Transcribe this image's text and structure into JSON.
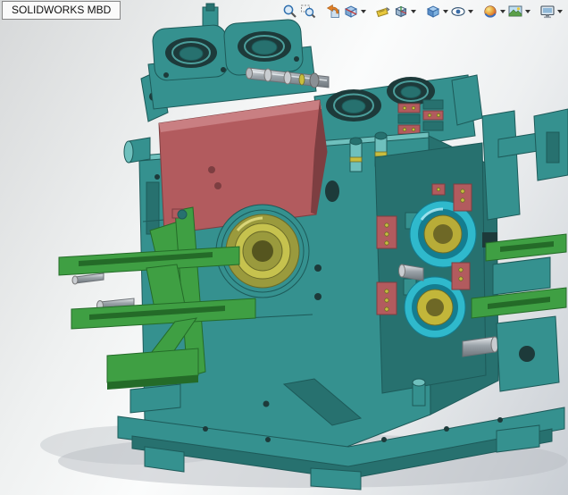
{
  "app": {
    "product_label": "SOLIDWORKS MBD"
  },
  "toolbar": {
    "items": [
      {
        "name": "zoom-to-fit",
        "icon": "magnifier-icon",
        "has_dropdown": false
      },
      {
        "name": "zoom-to-area",
        "icon": "magnifier-area-icon",
        "has_dropdown": false
      },
      {
        "name": "previous-view",
        "icon": "previous-view-arrow-icon",
        "has_dropdown": false
      },
      {
        "name": "section-view",
        "icon": "section-cube-icon",
        "has_dropdown": true
      },
      {
        "name": "dynamic-annotation-views",
        "icon": "annotation-tag-icon",
        "has_dropdown": false
      },
      {
        "name": "view-orientation",
        "icon": "orientation-cube-icon",
        "has_dropdown": true
      },
      {
        "name": "display-style",
        "icon": "shaded-cube-icon",
        "has_dropdown": true
      },
      {
        "name": "hide-show-items",
        "icon": "eye-icon",
        "has_dropdown": true
      },
      {
        "name": "edit-appearance",
        "icon": "appearance-ball-icon",
        "has_dropdown": true
      },
      {
        "name": "apply-scene",
        "icon": "scene-photo-icon",
        "has_dropdown": true
      },
      {
        "name": "view-settings",
        "icon": "monitor-icon",
        "has_dropdown": true
      }
    ]
  },
  "palette": {
    "bg-top": "#d6d8d9",
    "bg-mid": "#fbfcfc",
    "bg-bottom": "#c9ced4",
    "teal": "#35918f",
    "teal-dark": "#1d5a59",
    "teal-side": "#27716f",
    "teal-light": "#6fc0bd",
    "red-plate": "#b25b5e",
    "red-dark": "#7d3e41",
    "red-light": "#c97f82",
    "green": "#3f9f43",
    "green-dark": "#246b28",
    "olive": "#9a9a3d",
    "olive-light": "#c6c24e",
    "olive-dark": "#6b6b28",
    "cyan-ring": "#2fb9cc",
    "cyan-dark": "#147d90",
    "yellow": "#c9bd3e",
    "gray-metal": "#a3a8ad",
    "hole": "#1d3a3a",
    "shadow": "#b9bec3"
  }
}
